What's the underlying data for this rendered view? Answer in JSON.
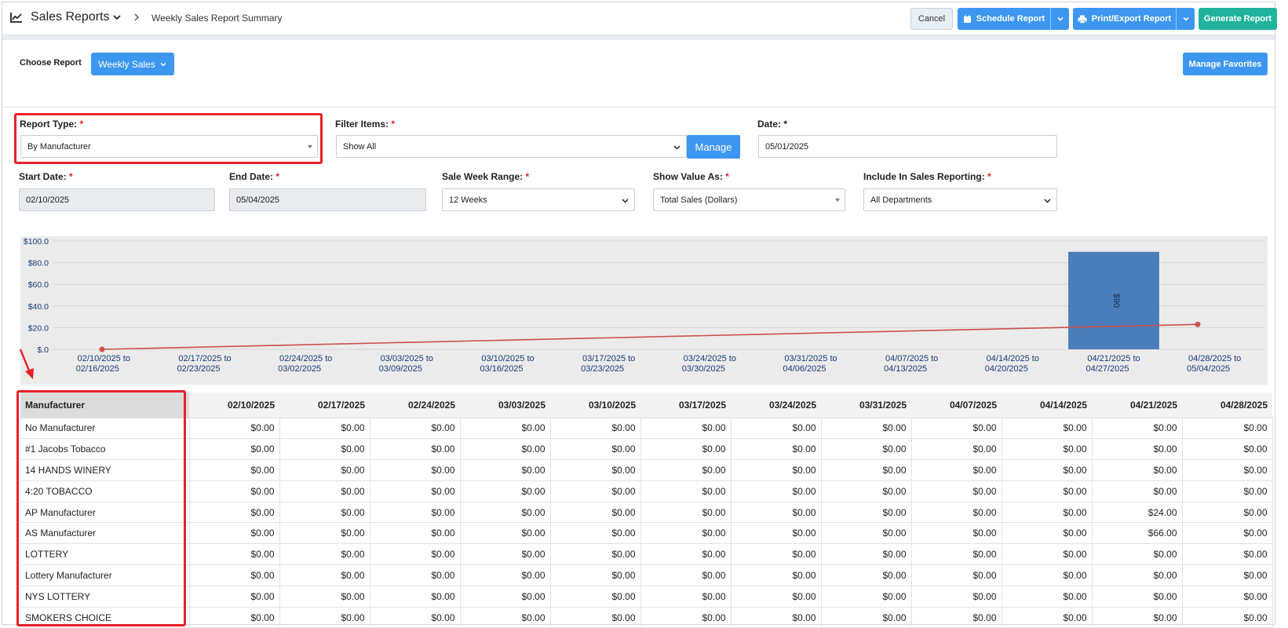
{
  "header": {
    "title": "Sales Reports",
    "breadcrumb": "Weekly Sales Report Summary",
    "cancel_label": "Cancel",
    "schedule_label": "Schedule Report",
    "print_label": "Print/Export Report",
    "generate_label": "Generate Report"
  },
  "chooser": {
    "label": "Choose Report",
    "selected": "Weekly Sales",
    "manage_favorites": "Manage Favorites"
  },
  "form": {
    "report_type": {
      "label": "Report Type:",
      "value": "By Manufacturer"
    },
    "filter_items": {
      "label": "Filter Items:",
      "value": "Show All",
      "manage": "Manage"
    },
    "date": {
      "label": "Date:",
      "value": "05/01/2025"
    },
    "start_date": {
      "label": "Start Date:",
      "value": "02/10/2025"
    },
    "end_date": {
      "label": "End Date:",
      "value": "05/04/2025"
    },
    "week_range": {
      "label": "Sale Week Range:",
      "value": "12 Weeks"
    },
    "show_value": {
      "label": "Show Value As:",
      "value": "Total Sales (Dollars)"
    },
    "include": {
      "label": "Include In Sales Reporting:",
      "value": "All Departments"
    },
    "required_mark": "*"
  },
  "chart_data": {
    "type": "bar",
    "categories": [
      [
        "02/10/2025 to",
        "02/16/2025"
      ],
      [
        "02/17/2025 to",
        "02/23/2025"
      ],
      [
        "02/24/2025 to",
        "03/02/2025"
      ],
      [
        "03/03/2025 to",
        "03/09/2025"
      ],
      [
        "03/10/2025 to",
        "03/16/2025"
      ],
      [
        "03/17/2025 to",
        "03/23/2025"
      ],
      [
        "03/24/2025 to",
        "03/30/2025"
      ],
      [
        "03/31/2025 to",
        "04/06/2025"
      ],
      [
        "04/07/2025 to",
        "04/13/2025"
      ],
      [
        "04/14/2025 to",
        "04/20/2025"
      ],
      [
        "04/21/2025 to",
        "04/27/2025"
      ],
      [
        "04/28/2025 to",
        "05/04/2025"
      ]
    ],
    "values": [
      0,
      0,
      0,
      0,
      0,
      0,
      0,
      0,
      0,
      0,
      90,
      0
    ],
    "data_labels": [
      "",
      "",
      "",
      "",
      "",
      "",
      "",
      "",
      "",
      "",
      "$90",
      ""
    ],
    "trend": {
      "start": 0,
      "end": 23
    },
    "y_ticks": [
      "$100.0",
      "$80.0",
      "$60.0",
      "$40.0",
      "$20.0",
      "$.0"
    ],
    "ylim": [
      0,
      100
    ],
    "grid": true,
    "bar_color": "#4a7ebb",
    "trend_color": "#c9504e"
  },
  "table": {
    "columns": [
      "Manufacturer",
      "02/10/2025",
      "02/17/2025",
      "02/24/2025",
      "03/03/2025",
      "03/10/2025",
      "03/17/2025",
      "03/24/2025",
      "03/31/2025",
      "04/07/2025",
      "04/14/2025",
      "04/21/2025",
      "04/28/2025"
    ],
    "rows": [
      [
        "No Manufacturer",
        "$0.00",
        "$0.00",
        "$0.00",
        "$0.00",
        "$0.00",
        "$0.00",
        "$0.00",
        "$0.00",
        "$0.00",
        "$0.00",
        "$0.00",
        "$0.00"
      ],
      [
        "#1 Jacobs Tobacco",
        "$0.00",
        "$0.00",
        "$0.00",
        "$0.00",
        "$0.00",
        "$0.00",
        "$0.00",
        "$0.00",
        "$0.00",
        "$0.00",
        "$0.00",
        "$0.00"
      ],
      [
        "14 HANDS WINERY",
        "$0.00",
        "$0.00",
        "$0.00",
        "$0.00",
        "$0.00",
        "$0.00",
        "$0.00",
        "$0.00",
        "$0.00",
        "$0.00",
        "$0.00",
        "$0.00"
      ],
      [
        "4:20 TOBACCO",
        "$0.00",
        "$0.00",
        "$0.00",
        "$0.00",
        "$0.00",
        "$0.00",
        "$0.00",
        "$0.00",
        "$0.00",
        "$0.00",
        "$0.00",
        "$0.00"
      ],
      [
        "AP Manufacturer",
        "$0.00",
        "$0.00",
        "$0.00",
        "$0.00",
        "$0.00",
        "$0.00",
        "$0.00",
        "$0.00",
        "$0.00",
        "$0.00",
        "$24.00",
        "$0.00"
      ],
      [
        "AS Manufacturer",
        "$0.00",
        "$0.00",
        "$0.00",
        "$0.00",
        "$0.00",
        "$0.00",
        "$0.00",
        "$0.00",
        "$0.00",
        "$0.00",
        "$66.00",
        "$0.00"
      ],
      [
        "LOTTERY",
        "$0.00",
        "$0.00",
        "$0.00",
        "$0.00",
        "$0.00",
        "$0.00",
        "$0.00",
        "$0.00",
        "$0.00",
        "$0.00",
        "$0.00",
        "$0.00"
      ],
      [
        "Lottery Manufacturer",
        "$0.00",
        "$0.00",
        "$0.00",
        "$0.00",
        "$0.00",
        "$0.00",
        "$0.00",
        "$0.00",
        "$0.00",
        "$0.00",
        "$0.00",
        "$0.00"
      ],
      [
        "NYS LOTTERY",
        "$0.00",
        "$0.00",
        "$0.00",
        "$0.00",
        "$0.00",
        "$0.00",
        "$0.00",
        "$0.00",
        "$0.00",
        "$0.00",
        "$0.00",
        "$0.00"
      ],
      [
        "SMOKERS CHOICE",
        "$0.00",
        "$0.00",
        "$0.00",
        "$0.00",
        "$0.00",
        "$0.00",
        "$0.00",
        "$0.00",
        "$0.00",
        "$0.00",
        "$0.00",
        "$0.00"
      ]
    ]
  },
  "colors": {
    "primary": "#3d97f0",
    "generate": "#1fb39b",
    "highlight": "#e8202a"
  },
  "icons": [
    "chart-line-icon",
    "chevron-down-icon",
    "breadcrumb-chevron-icon",
    "calendar-icon",
    "printer-icon",
    "annotation-arrow-icon"
  ]
}
